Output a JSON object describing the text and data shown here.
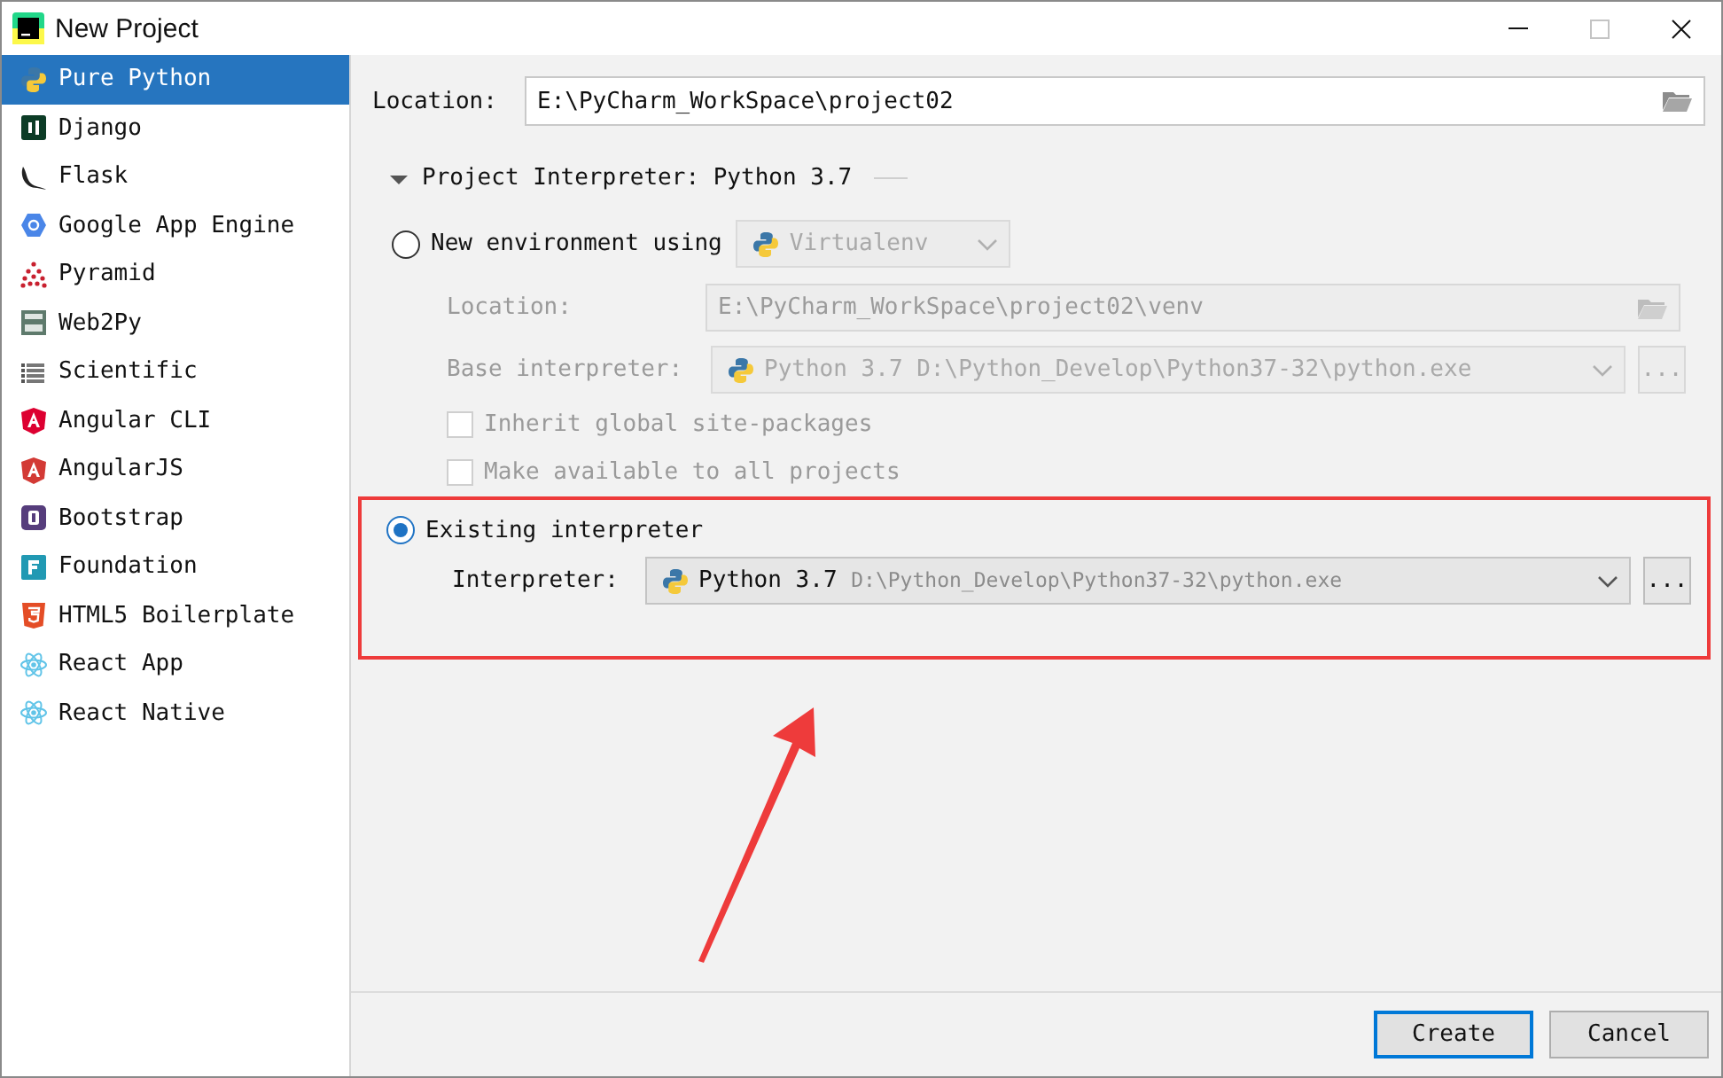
{
  "window": {
    "title": "New Project"
  },
  "sidebar": {
    "items": [
      {
        "label": "Pure Python",
        "kind": "python",
        "selected": true
      },
      {
        "label": "Django",
        "kind": "django",
        "selected": false
      },
      {
        "label": "Flask",
        "kind": "flask",
        "selected": false
      },
      {
        "label": "Google App Engine",
        "kind": "gae",
        "selected": false
      },
      {
        "label": "Pyramid",
        "kind": "pyramid",
        "selected": false
      },
      {
        "label": "Web2Py",
        "kind": "web2py",
        "selected": false
      },
      {
        "label": "Scientific",
        "kind": "scientific",
        "selected": false
      },
      {
        "label": "Angular CLI",
        "kind": "angularcli",
        "selected": false
      },
      {
        "label": "AngularJS",
        "kind": "angularjs",
        "selected": false
      },
      {
        "label": "Bootstrap",
        "kind": "bootstrap",
        "selected": false
      },
      {
        "label": "Foundation",
        "kind": "foundation",
        "selected": false
      },
      {
        "label": "HTML5 Boilerplate",
        "kind": "html5",
        "selected": false
      },
      {
        "label": "React App",
        "kind": "react",
        "selected": false
      },
      {
        "label": "React Native",
        "kind": "react",
        "selected": false
      }
    ]
  },
  "location": {
    "label": "Location:",
    "value": "E:\\PyCharm_WorkSpace\\project02"
  },
  "interpreter_section": {
    "title": "Project Interpreter: Python 3.7",
    "expanded": true
  },
  "new_environment": {
    "label": "New environment using",
    "selected": false,
    "tool": "Virtualenv",
    "location": {
      "label": "Location:",
      "value": "E:\\PyCharm_WorkSpace\\project02\\venv"
    },
    "base_interpreter": {
      "label": "Base interpreter:",
      "value": "Python 3.7 D:\\Python_Develop\\Python37-32\\python.exe"
    },
    "checkboxes": [
      {
        "label": "Inherit global site-packages",
        "checked": false
      },
      {
        "label": "Make available to all projects",
        "checked": false
      }
    ]
  },
  "existing_interpreter": {
    "label": "Existing interpreter",
    "selected": true,
    "interpreter": {
      "label": "Interpreter:",
      "name": "Python 3.7",
      "path": "D:\\Python_Develop\\Python37-32\\python.exe"
    },
    "browse": "..."
  },
  "browse_base": "...",
  "buttons": [
    {
      "label": "Create",
      "kind": "default"
    },
    {
      "label": "Cancel",
      "kind": "normal"
    }
  ]
}
